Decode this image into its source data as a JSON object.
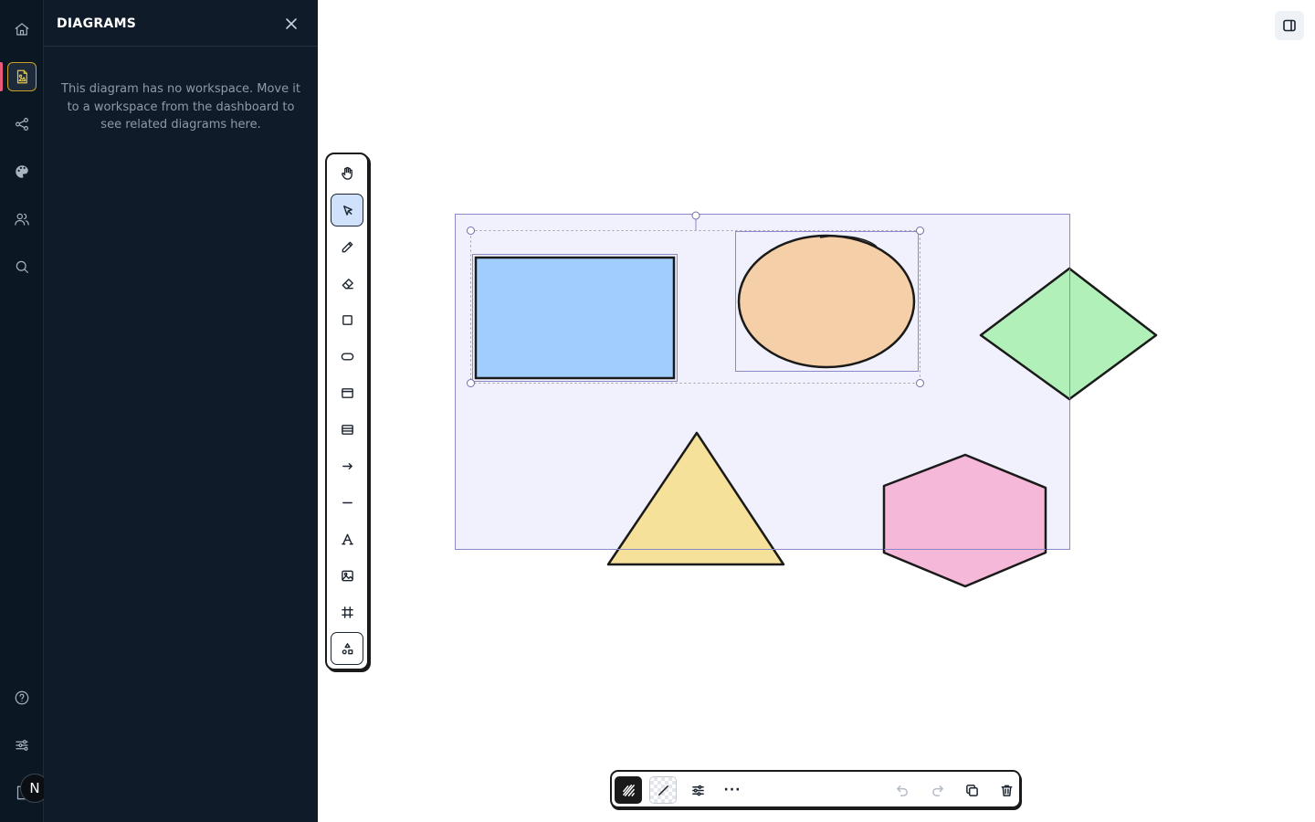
{
  "rail": {
    "items": [
      {
        "name": "home",
        "icon": "home-icon"
      },
      {
        "name": "diagrams",
        "icon": "diagram-file-icon",
        "active": true
      },
      {
        "name": "share",
        "icon": "share-icon"
      },
      {
        "name": "theme",
        "icon": "palette-icon"
      },
      {
        "name": "team",
        "icon": "users-icon"
      },
      {
        "name": "search",
        "icon": "search-icon"
      }
    ],
    "bottom_items": [
      {
        "name": "help",
        "icon": "help-icon"
      },
      {
        "name": "settings",
        "icon": "sliders-icon"
      }
    ],
    "avatar_initial": "N"
  },
  "panel": {
    "title": "DIAGRAMS",
    "close_icon": "close-icon",
    "empty_message": "This diagram has no workspace. Move it to a workspace from the dashboard to see related diagrams here."
  },
  "toolbar": {
    "tools": [
      {
        "name": "hand",
        "icon": "hand-icon"
      },
      {
        "name": "select",
        "icon": "pointer-icon",
        "selected": true
      },
      {
        "name": "pencil",
        "icon": "pencil-icon"
      },
      {
        "name": "eraser",
        "icon": "eraser-icon"
      },
      {
        "name": "rectangle",
        "icon": "square-icon"
      },
      {
        "name": "ellipse",
        "icon": "pill-icon"
      },
      {
        "name": "window",
        "icon": "window-icon"
      },
      {
        "name": "table",
        "icon": "table-icon"
      },
      {
        "name": "arrow",
        "icon": "arrow-right-icon"
      },
      {
        "name": "line",
        "icon": "line-icon"
      },
      {
        "name": "text",
        "icon": "text-icon"
      },
      {
        "name": "image",
        "icon": "image-icon"
      },
      {
        "name": "frame",
        "icon": "frame-icon"
      },
      {
        "name": "shapes",
        "icon": "shapes-icon"
      }
    ]
  },
  "canvas": {
    "shapes": [
      {
        "name": "rectangle",
        "fill": "#a0cdfb"
      },
      {
        "name": "ellipse",
        "fill": "#f4cfa8"
      },
      {
        "name": "diamond",
        "fill": "#b1f1b9"
      },
      {
        "name": "triangle",
        "fill": "#f5e19a"
      },
      {
        "name": "hexagon",
        "fill": "#f6b8d8"
      }
    ],
    "frame_fill": "#f1f1fd",
    "selection_color": "#7d7cc4"
  },
  "actionbar": {
    "more_label": "···",
    "buttons": [
      "fill-style-icon",
      "stroke-style-icon",
      "adjust-icon",
      "more-icon",
      "undo-icon",
      "redo-icon",
      "duplicate-icon",
      "trash-icon"
    ]
  },
  "colors": {
    "rail_bg": "#0c1724",
    "panel_bg": "#0f1b29",
    "accent": "#e3c44a",
    "active_indicator": "#e85a7a"
  }
}
